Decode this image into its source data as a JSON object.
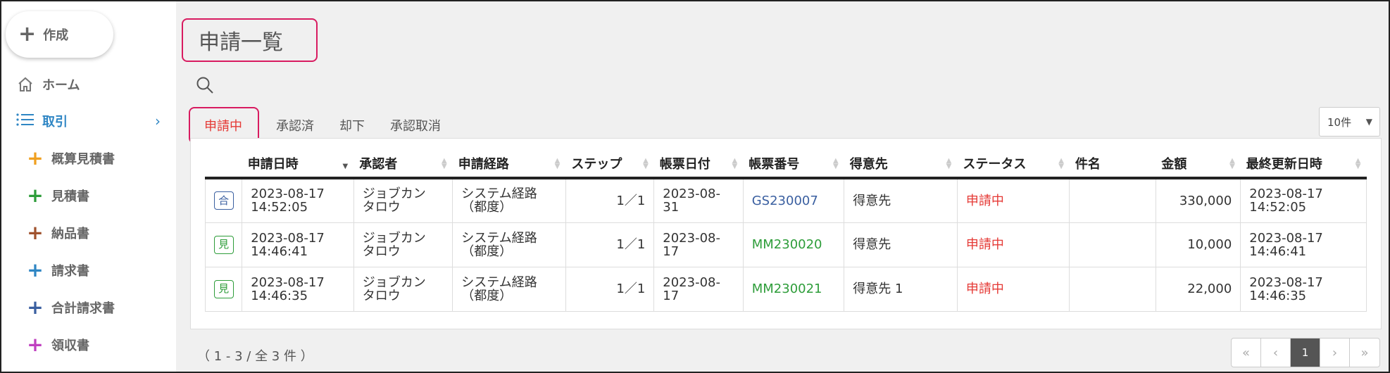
{
  "sidebar": {
    "create_label": "作成",
    "home_label": "ホーム",
    "tori_label": "取引",
    "items": [
      {
        "label": "概算見積書",
        "color": "#f0a020"
      },
      {
        "label": "見積書",
        "color": "#2e9d3a"
      },
      {
        "label": "納品書",
        "color": "#a0522d"
      },
      {
        "label": "請求書",
        "color": "#2f86c4"
      },
      {
        "label": "合計請求書",
        "color": "#3a5fa0"
      },
      {
        "label": "領収書",
        "color": "#c040c0"
      }
    ]
  },
  "main": {
    "title": "申請一覧",
    "tabs": [
      "申請中",
      "承認済",
      "却下",
      "承認取消"
    ],
    "per_page": "10件",
    "columns": [
      "申請日時",
      "承認者",
      "申請経路",
      "ステップ",
      "帳票日付",
      "帳票番号",
      "得意先",
      "ステータス",
      "件名",
      "金額",
      "最終更新日時"
    ],
    "rows": [
      {
        "badge": "合",
        "date1": "2023-08-17",
        "time1": "14:52:05",
        "approver1": "ジョブカン",
        "approver2": "タロウ",
        "route1": "システム経路",
        "route2": "（都度）",
        "step": "1／1",
        "doc_date": "2023-08-31",
        "doc_no": "GS230007",
        "customer": "得意先",
        "status": "申請中",
        "subject": "",
        "amount": "330,000",
        "udate": "2023-08-17",
        "utime": "14:52:05"
      },
      {
        "badge": "見",
        "date1": "2023-08-17",
        "time1": "14:46:41",
        "approver1": "ジョブカン",
        "approver2": "タロウ",
        "route1": "システム経路",
        "route2": "（都度）",
        "step": "1／1",
        "doc_date": "2023-08-17",
        "doc_no": "MM230020",
        "customer": "得意先",
        "status": "申請中",
        "subject": "",
        "amount": "10,000",
        "udate": "2023-08-17",
        "utime": "14:46:41"
      },
      {
        "badge": "見",
        "date1": "2023-08-17",
        "time1": "14:46:35",
        "approver1": "ジョブカン",
        "approver2": "タロウ",
        "route1": "システム経路",
        "route2": "（都度）",
        "step": "1／1",
        "doc_date": "2023-08-17",
        "doc_no": "MM230021",
        "customer": "得意先 1",
        "status": "申請中",
        "subject": "",
        "amount": "22,000",
        "udate": "2023-08-17",
        "utime": "14:46:35"
      }
    ],
    "footer_count": "（ 1 - 3 / 全 3 件 ）",
    "pager": {
      "first": "«",
      "prev": "‹",
      "current": "1",
      "next": "›",
      "last": "»"
    }
  }
}
